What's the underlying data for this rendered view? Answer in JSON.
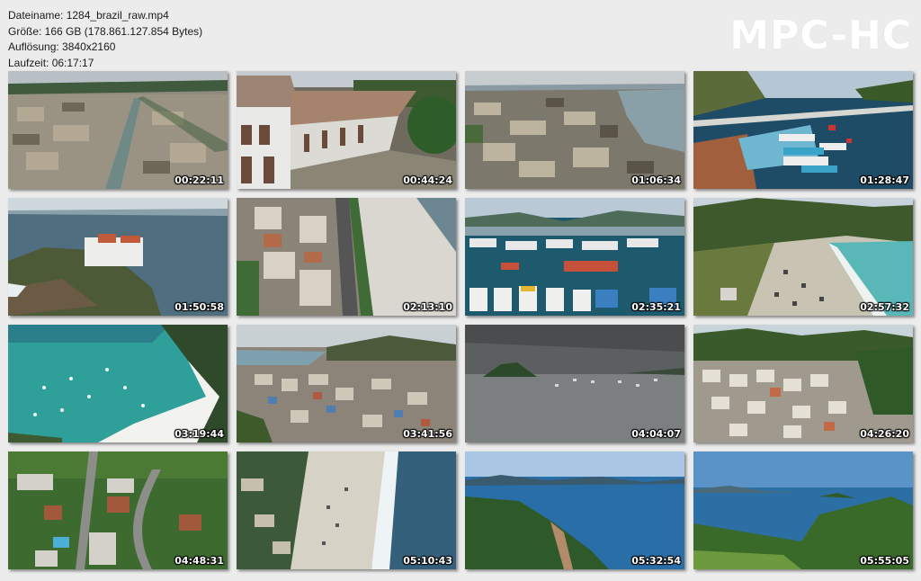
{
  "info": {
    "filename": "Dateiname: 1284_brazil_raw.mp4",
    "size": "Größe: 166 GB (178.861.127.854 Bytes)",
    "resolution": "Auflösung: 3840x2160",
    "duration": "Laufzeit: 06:17:17"
  },
  "logo": "MPC-HC",
  "thumbnails": [
    {
      "time": "00:22:11",
      "scene": "town-canal-aerial"
    },
    {
      "time": "00:44:24",
      "scene": "colonial-house-rooftop"
    },
    {
      "time": "01:06:34",
      "scene": "city-bay-aerial"
    },
    {
      "time": "01:28:47",
      "scene": "harbor-boats-bridge"
    },
    {
      "time": "01:50:58",
      "scene": "fort-on-rocky-point"
    },
    {
      "time": "02:13:10",
      "scene": "beachfront-city-street"
    },
    {
      "time": "02:35:21",
      "scene": "marina-boats"
    },
    {
      "time": "02:57:32",
      "scene": "beach-cove-hills"
    },
    {
      "time": "03:19:44",
      "scene": "turquoise-bay-boats"
    },
    {
      "time": "03:41:56",
      "scene": "hillside-favela"
    },
    {
      "time": "04:04:07",
      "scene": "gray-sea-island"
    },
    {
      "time": "04:26:20",
      "scene": "hill-town-houses"
    },
    {
      "time": "04:48:31",
      "scene": "residential-green-aerial"
    },
    {
      "time": "05:10:43",
      "scene": "beach-waves-aerial"
    },
    {
      "time": "05:32:54",
      "scene": "blue-bay-green-cliff"
    },
    {
      "time": "05:55:05",
      "scene": "ocean-view-trees"
    }
  ]
}
